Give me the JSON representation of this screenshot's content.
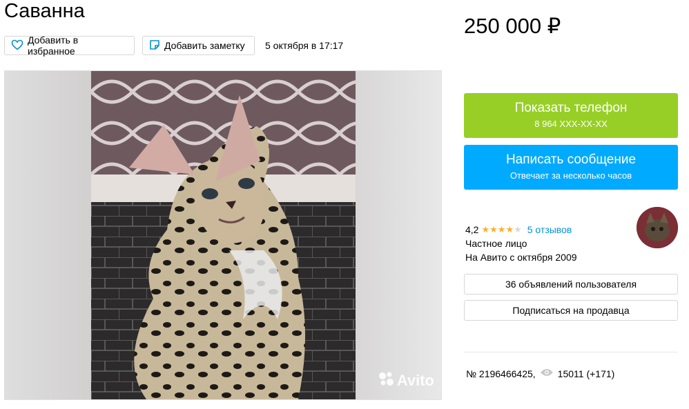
{
  "listing": {
    "title": "Саванна",
    "date": "5 октября в 17:17",
    "favorite_label": "Добавить в избранное",
    "note_label": "Добавить заметку",
    "photo_watermark": "Avito"
  },
  "sidebar": {
    "price": "250 000 ₽",
    "phone_button": {
      "label": "Показать телефон",
      "sub": "8 964 XXX-XX-XX"
    },
    "message_button": {
      "label": "Написать сообщение",
      "sub": "Отвечает за несколько часов"
    },
    "seller": {
      "rating": "4,2",
      "stars_filled": 4,
      "stars_total": 5,
      "reviews": "5 отзывов",
      "type": "Частное лицо",
      "since": "На Авито с октября 2009"
    },
    "ads_button": "36 объявлений пользователя",
    "subscribe_button": "Подписаться на продавца",
    "listing_number": "№ 2196466425,",
    "views": "15011 (+171)"
  },
  "colors": {
    "phone_button": "#97cf26",
    "message_button": "#00aaff",
    "link": "#0091d9",
    "star": "#ffb021"
  }
}
